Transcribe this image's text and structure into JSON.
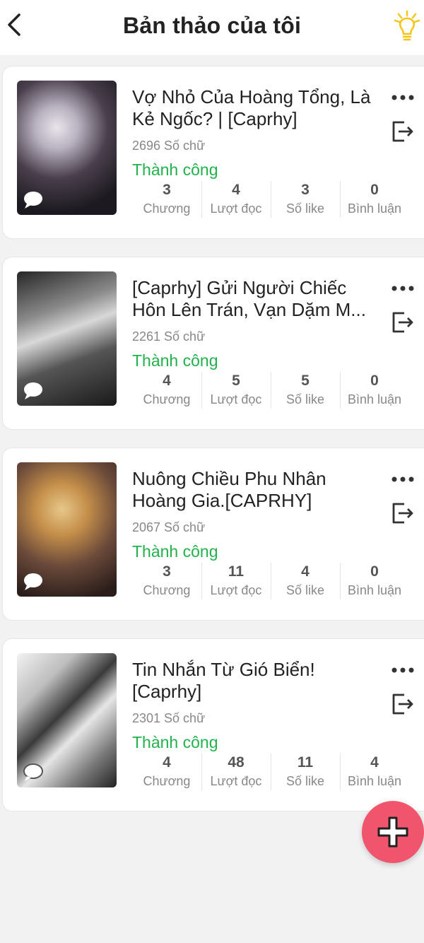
{
  "header": {
    "title": "Bản thảo của tôi"
  },
  "drafts": [
    {
      "title": "Vợ Nhỏ Của Hoàng Tổng, Là Kẻ Ngốc? | [Caprhy]",
      "word_count": "2696 Số chữ",
      "status": "Thành công",
      "stats": [
        {
          "value": "3",
          "label": "Chương"
        },
        {
          "value": "4",
          "label": "Lượt đọc"
        },
        {
          "value": "3",
          "label": "Số like"
        },
        {
          "value": "0",
          "label": "Bình luận"
        }
      ]
    },
    {
      "title": "[Caprhy] Gửi Người Chiếc Hôn Lên Trán, Vạn Dặm M...",
      "word_count": "2261 Số chữ",
      "status": "Thành công",
      "stats": [
        {
          "value": "4",
          "label": "Chương"
        },
        {
          "value": "5",
          "label": "Lượt đọc"
        },
        {
          "value": "5",
          "label": "Số like"
        },
        {
          "value": "0",
          "label": "Bình luận"
        }
      ]
    },
    {
      "title": "Nuông Chiều Phu Nhân Hoàng Gia.[CAPRHY]",
      "word_count": "2067 Số chữ",
      "status": "Thành công",
      "stats": [
        {
          "value": "3",
          "label": "Chương"
        },
        {
          "value": "11",
          "label": "Lượt đọc"
        },
        {
          "value": "4",
          "label": "Số like"
        },
        {
          "value": "0",
          "label": "Bình luận"
        }
      ]
    },
    {
      "title": "Tin Nhắn Từ Gió Biển! [Caprhy]",
      "word_count": "2301 Số chữ",
      "status": "Thành công",
      "stats": [
        {
          "value": "4",
          "label": "Chương"
        },
        {
          "value": "48",
          "label": "Lượt đọc"
        },
        {
          "value": "11",
          "label": "Số like"
        },
        {
          "value": "4",
          "label": "Bình luận"
        }
      ]
    }
  ],
  "icons": {
    "back": "chevron-left-icon",
    "tip": "lightbulb-icon",
    "more": "more-dots-icon",
    "exit": "exit-icon",
    "comment": "comment-bubble-icon",
    "add": "plus-icon"
  },
  "colors": {
    "status_success": "#22b24c",
    "fab": "#f1546d",
    "bulb": "#f5c518"
  }
}
